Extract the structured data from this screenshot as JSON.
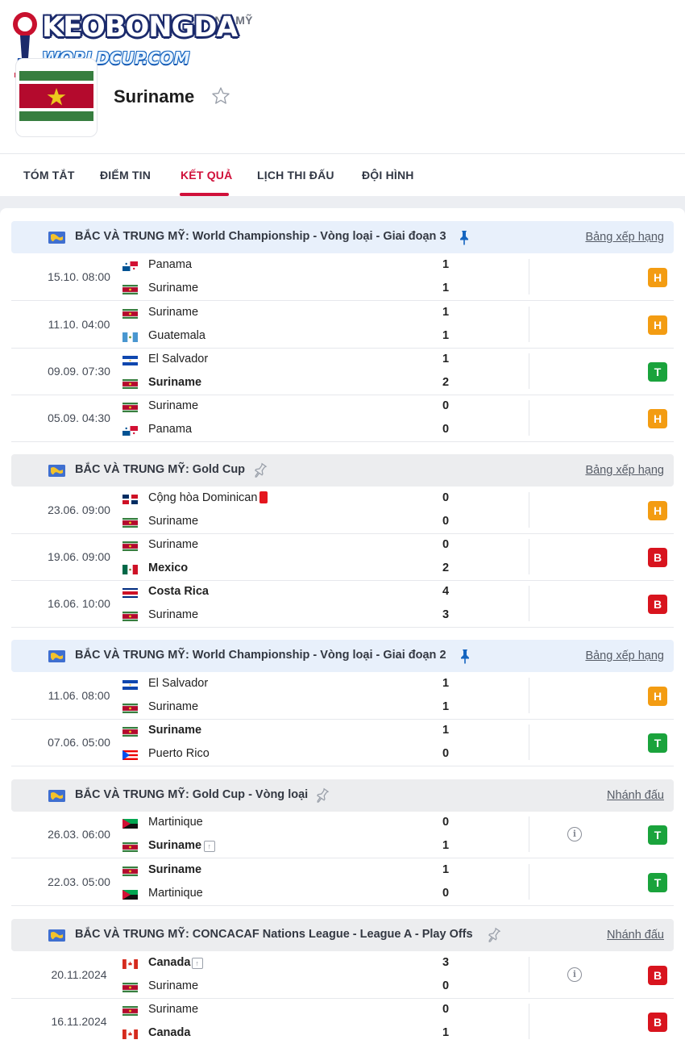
{
  "breadcrumb": "UNG MỸ",
  "logo": {
    "line1": "KEOBONGDA",
    "line2": "WORLDCUP.COM"
  },
  "team": {
    "name": "Suriname"
  },
  "tabs": [
    {
      "label": "TÓM TẮT",
      "active": false
    },
    {
      "label": "ĐIỂM TIN",
      "active": false
    },
    {
      "label": "KẾT QUẢ",
      "active": true
    },
    {
      "label": "LỊCH THI ĐẤU",
      "active": false
    },
    {
      "label": "ĐỘI HÌNH",
      "active": false
    }
  ],
  "colors": {
    "accent": "#d0103a",
    "draw": "#f39c12",
    "win": "#1aa33c",
    "loss": "#d8141e"
  },
  "sections": [
    {
      "title": "BẮC VÀ TRUNG MỸ: World Championship - Vòng loại - Giai đoạn 3",
      "style": "blue",
      "pinned": true,
      "link": "Bảng xếp hạng",
      "matches": [
        {
          "time": "15.10. 08:00",
          "home": "Panama",
          "home_flag": "panama",
          "away": "Suriname",
          "away_flag": "suriname",
          "home_score": "1",
          "away_score": "1",
          "result": "H",
          "home_win": false,
          "away_win": false
        },
        {
          "time": "11.10. 04:00",
          "home": "Suriname",
          "home_flag": "suriname",
          "away": "Guatemala",
          "away_flag": "guatemala",
          "home_score": "1",
          "away_score": "1",
          "result": "H",
          "home_win": false,
          "away_win": false
        },
        {
          "time": "09.09. 07:30",
          "home": "El Salvador",
          "home_flag": "elsalvador",
          "away": "Suriname",
          "away_flag": "suriname",
          "home_score": "1",
          "away_score": "2",
          "result": "T",
          "home_win": false,
          "away_win": true
        },
        {
          "time": "05.09. 04:30",
          "home": "Suriname",
          "home_flag": "suriname",
          "away": "Panama",
          "away_flag": "panama",
          "home_score": "0",
          "away_score": "0",
          "result": "H",
          "home_win": false,
          "away_win": false
        }
      ]
    },
    {
      "title": "BẮC VÀ TRUNG MỸ: Gold Cup",
      "style": "gray",
      "pinned": false,
      "link": "Bảng xếp hạng",
      "matches": [
        {
          "time": "23.06. 09:00",
          "home": "Cộng hòa Dominican",
          "home_flag": "dominican",
          "away": "Suriname",
          "away_flag": "suriname",
          "home_score": "0",
          "away_score": "0",
          "result": "H",
          "home_win": false,
          "away_win": false,
          "home_redcard": true
        },
        {
          "time": "19.06. 09:00",
          "home": "Suriname",
          "home_flag": "suriname",
          "away": "Mexico",
          "away_flag": "mexico",
          "home_score": "0",
          "away_score": "2",
          "result": "B",
          "home_win": false,
          "away_win": true
        },
        {
          "time": "16.06. 10:00",
          "home": "Costa Rica",
          "home_flag": "costarica",
          "away": "Suriname",
          "away_flag": "suriname",
          "home_score": "4",
          "away_score": "3",
          "result": "B",
          "home_win": true,
          "away_win": false
        }
      ]
    },
    {
      "title": "BẮC VÀ TRUNG MỸ: World Championship - Vòng loại - Giai đoạn 2",
      "style": "blue",
      "pinned": true,
      "link": "Bảng xếp hạng",
      "matches": [
        {
          "time": "11.06. 08:00",
          "home": "El Salvador",
          "home_flag": "elsalvador",
          "away": "Suriname",
          "away_flag": "suriname",
          "home_score": "1",
          "away_score": "1",
          "result": "H",
          "home_win": false,
          "away_win": false
        },
        {
          "time": "07.06. 05:00",
          "home": "Suriname",
          "home_flag": "suriname",
          "away": "Puerto Rico",
          "away_flag": "puertorico",
          "home_score": "1",
          "away_score": "0",
          "result": "T",
          "home_win": true,
          "away_win": false
        }
      ]
    },
    {
      "title": "BẮC VÀ TRUNG MỸ: Gold Cup - Vòng loại",
      "style": "gray",
      "pinned": false,
      "link": "Nhánh đấu",
      "matches": [
        {
          "time": "26.03. 06:00",
          "home": "Martinique",
          "home_flag": "martinique",
          "away": "Suriname",
          "away_flag": "suriname",
          "home_score": "0",
          "away_score": "1",
          "result": "T",
          "home_win": false,
          "away_win": true,
          "away_advance": true,
          "info": true
        },
        {
          "time": "22.03. 05:00",
          "home": "Suriname",
          "home_flag": "suriname",
          "away": "Martinique",
          "away_flag": "martinique",
          "home_score": "1",
          "away_score": "0",
          "result": "T",
          "home_win": true,
          "away_win": false
        }
      ]
    },
    {
      "title": "BẮC VÀ TRUNG MỸ: CONCACAF Nations League - League A - Play Offs",
      "style": "gray",
      "pinned": false,
      "link": "Nhánh đấu",
      "matches": [
        {
          "time": "20.11.2024",
          "home": "Canada",
          "home_flag": "canada",
          "away": "Suriname",
          "away_flag": "suriname",
          "home_score": "3",
          "away_score": "0",
          "result": "B",
          "home_win": true,
          "away_win": false,
          "home_advance": true,
          "info": true
        },
        {
          "time": "16.11.2024",
          "home": "Suriname",
          "home_flag": "suriname",
          "away": "Canada",
          "away_flag": "canada",
          "home_score": "0",
          "away_score": "1",
          "result": "B",
          "home_win": false,
          "away_win": true
        }
      ]
    }
  ]
}
